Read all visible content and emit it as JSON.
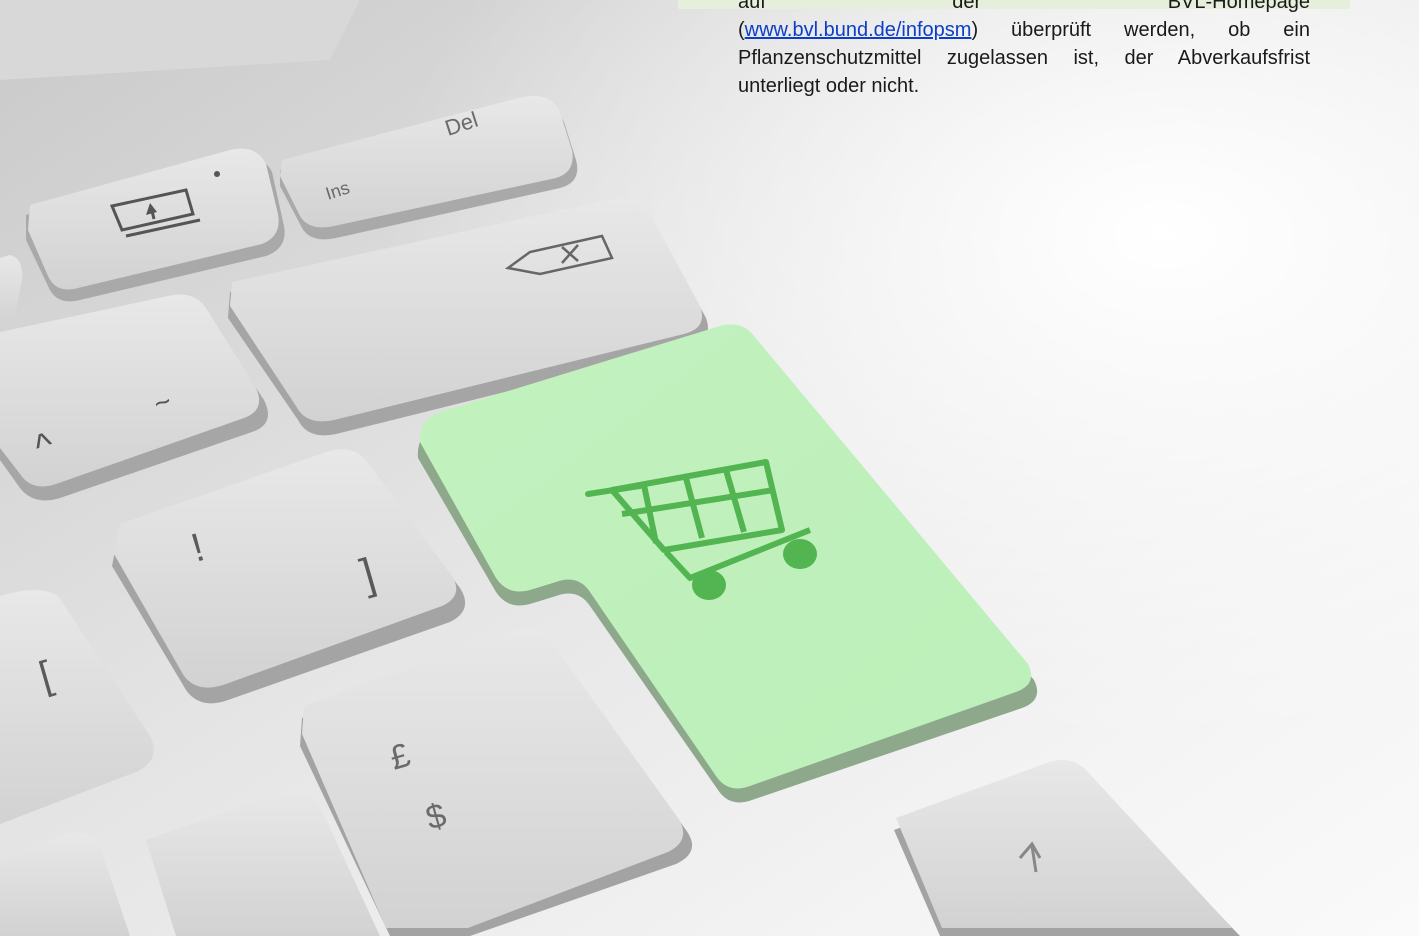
{
  "text_block": {
    "line1": [
      "auf",
      "der",
      "BVL-Homepage"
    ],
    "paren_open": "(",
    "link": "www.bvl.bund.de/infopsm",
    "after_link": ") überprüft werden, ob ein Pflanzenschutzmittel zugelassen ist, der Abverkaufsfrist unterliegt oder nicht."
  },
  "keys": {
    "del": "Del",
    "ins": "Ins",
    "tilde": "~",
    "caret": "^",
    "exclam": "!",
    "bracket_close": "]",
    "bracket_open": "[",
    "pound": "£",
    "dollar": "$"
  },
  "colors": {
    "enter_key": "#c3f2c0",
    "cart": "#52b552",
    "key": "#dcdcdc"
  },
  "icons": [
    "upload-icon",
    "backspace-icon",
    "shopping-cart-icon",
    "up-arrow-icon"
  ]
}
